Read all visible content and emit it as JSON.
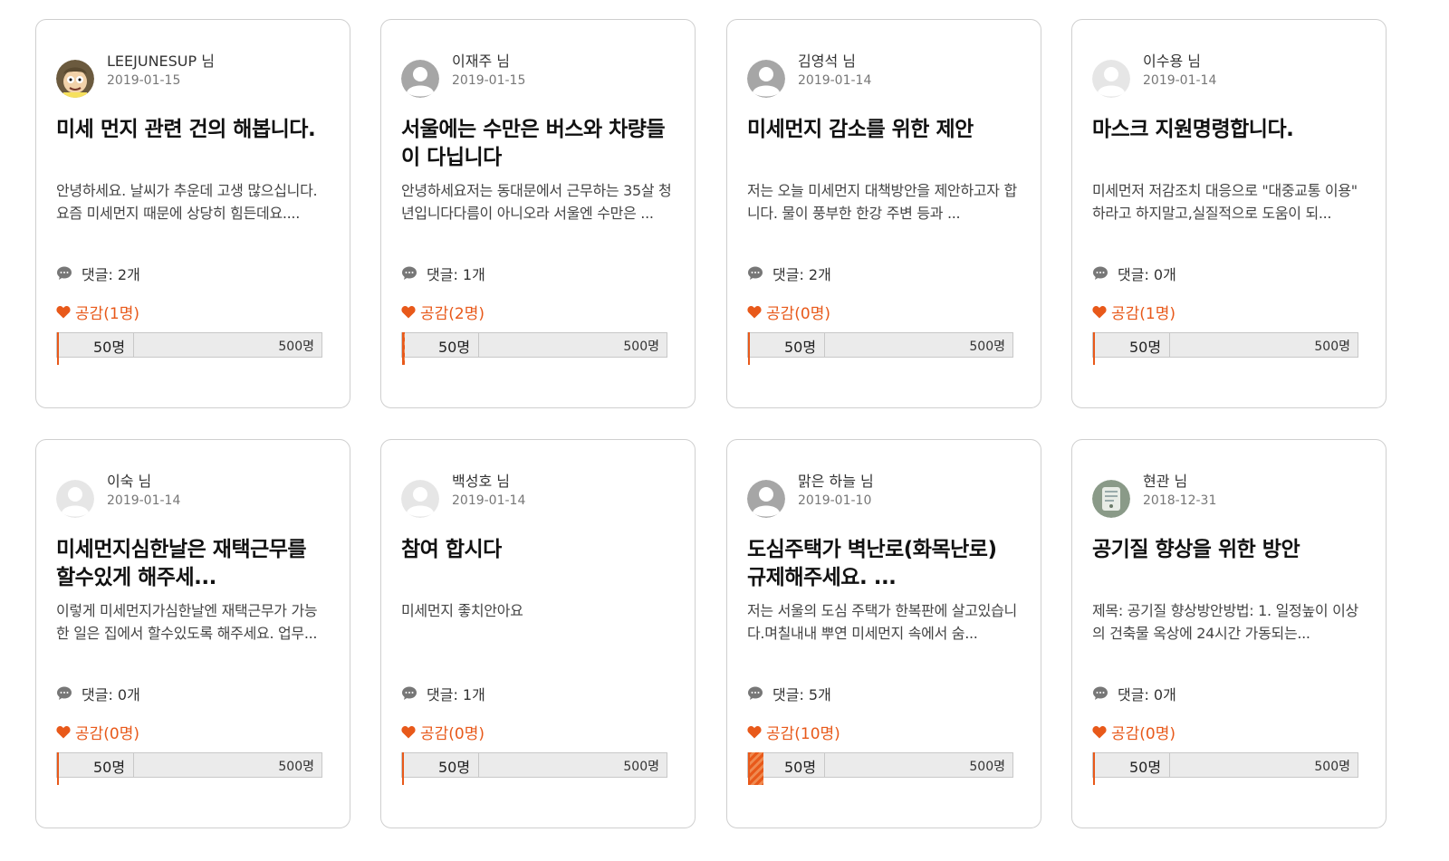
{
  "colors": {
    "accent": "#e8591a",
    "border": "#cfcfcf",
    "bar": "#ebebeb"
  },
  "cards": [
    {
      "author": "LEEJUNESUP 님",
      "date": "2019-01-15",
      "avatar": "cartoon-avatar",
      "title": "미세 먼지 관련 건의 해봅니다.",
      "excerpt": "안녕하세요. 날씨가 추운데 고생 많으십니다.요즘 미세먼지 때문에 상당히 힘든데요....",
      "comments": "댓글: 2개",
      "likes": "공감(1명)",
      "likes_count": 1,
      "min_label": "50명",
      "max_label": "500명"
    },
    {
      "author": "이재주 님",
      "date": "2019-01-15",
      "avatar": "default-dark",
      "title": "서울에는 수만은 버스와 차량들이 다닙니다",
      "excerpt": "안녕하세요저는 동대문에서 근무하는 35살 청년입니다다름이 아니오라 서울엔 수만은 ...",
      "comments": "댓글: 1개",
      "likes": "공감(2명)",
      "likes_count": 2,
      "min_label": "50명",
      "max_label": "500명"
    },
    {
      "author": "김영석 님",
      "date": "2019-01-14",
      "avatar": "default-dark",
      "title": "미세먼지 감소를 위한 제안",
      "excerpt": "저는 오늘 미세먼지 대책방안을 제안하고자 합니다. 물이 풍부한 한강 주변 등과 ...",
      "comments": "댓글: 2개",
      "likes": "공감(0명)",
      "likes_count": 0,
      "min_label": "50명",
      "max_label": "500명"
    },
    {
      "author": "이수용 님",
      "date": "2019-01-14",
      "avatar": "default-light",
      "title": "마스크 지원명령합니다.",
      "excerpt": "미세먼저 저감조치 대응으로 \"대중교통 이용\" 하라고 하지말고,실질적으로 도움이 되...",
      "comments": "댓글: 0개",
      "likes": "공감(1명)",
      "likes_count": 1,
      "min_label": "50명",
      "max_label": "500명"
    },
    {
      "author": "이숙 님",
      "date": "2019-01-14",
      "avatar": "default-light",
      "title": "미세먼지심한날은 재택근무를 할수있게 해주세...",
      "excerpt": "이렇게 미세먼지가심한날엔 재택근무가 가능한 일은 집에서 할수있도록 해주세요. 업무...",
      "comments": "댓글: 0개",
      "likes": "공감(0명)",
      "likes_count": 0,
      "min_label": "50명",
      "max_label": "500명"
    },
    {
      "author": "백성호 님",
      "date": "2019-01-14",
      "avatar": "default-light",
      "title": "참여 합시다",
      "excerpt": "미세먼지 좋치안아요",
      "comments": "댓글: 1개",
      "likes": "공감(0명)",
      "likes_count": 0,
      "min_label": "50명",
      "max_label": "500명"
    },
    {
      "author": "맑은 하늘 님",
      "date": "2019-01-10",
      "avatar": "default-dark",
      "title": "도심주택가 벽난로(화목난로) 규제해주세요. ...",
      "excerpt": "저는 서울의 도심 주택가 한복판에 살고있습니다.며칠내내 뿌연 미세먼지 속에서 숨...",
      "comments": "댓글: 5개",
      "likes": "공감(10명)",
      "likes_count": 10,
      "min_label": "50명",
      "max_label": "500명"
    },
    {
      "author": "현관 님",
      "date": "2018-12-31",
      "avatar": "photo-avatar",
      "title": "공기질 향상을 위한 방안",
      "excerpt": "제목: 공기질 향상방안방법: 1. 일정높이 이상의 건축물 옥상에 24시간 가동되는...",
      "comments": "댓글: 0개",
      "likes": "공감(0명)",
      "likes_count": 0,
      "min_label": "50명",
      "max_label": "500명"
    }
  ]
}
